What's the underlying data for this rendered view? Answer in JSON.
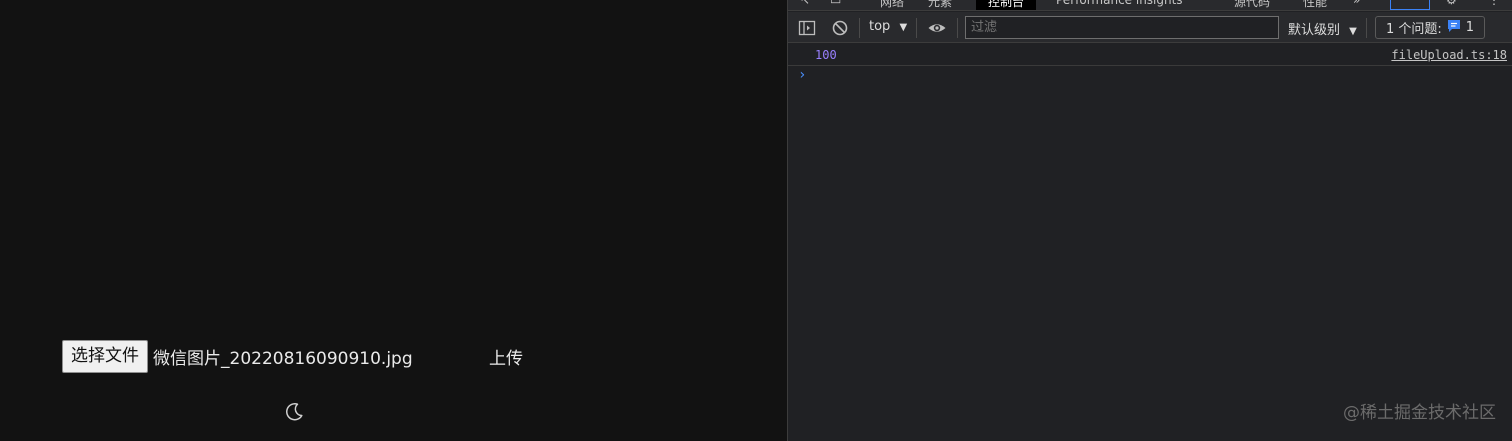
{
  "page": {
    "choose_file_label": "选择文件",
    "file_name": "微信图片_20220816090910.jpg",
    "upload_label": "上传",
    "theme_icon": "moon-icon"
  },
  "devtools": {
    "tabs": [
      {
        "label": "网络"
      },
      {
        "label": "元素"
      },
      {
        "label": "控制台"
      },
      {
        "label": "Performance insights"
      },
      {
        "label": "源代码"
      },
      {
        "label": "性能"
      },
      {
        "label": "»"
      }
    ],
    "toolbar": {
      "context": "top",
      "filter_placeholder": "过滤",
      "levels": "默认级别",
      "issues_label": "1 个问题:",
      "issues_count": "1"
    },
    "console": {
      "log_value": "100",
      "log_source": "fileUpload.ts:18",
      "prompt_symbol": "›"
    },
    "watermark": "@稀土掘金技术社区"
  },
  "colors": {
    "page_bg": "#121212",
    "devtools_bg": "#202124",
    "log_number": "#9980ff",
    "prompt": "#4a90ff",
    "issue_icon": "#3b82f6"
  }
}
